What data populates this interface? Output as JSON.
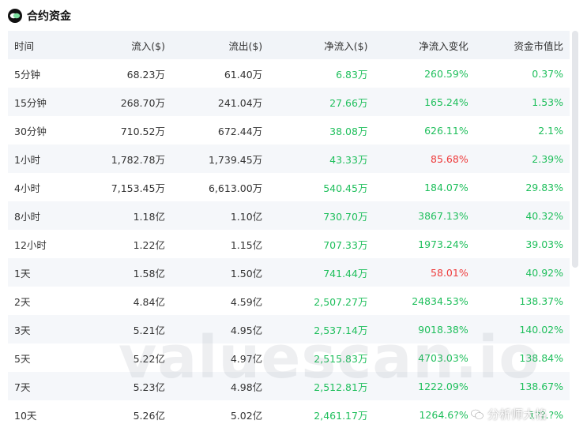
{
  "header": {
    "title": "合约资金"
  },
  "table": {
    "columns": [
      "时间",
      "流入($)",
      "流出($)",
      "净流入($)",
      "净流入变化",
      "资金市值比"
    ],
    "rows": [
      {
        "time": "5分钟",
        "inflow": "68.23万",
        "outflow": "61.40万",
        "net": "6.83万",
        "change": "260.59%",
        "ratio": "0.37%"
      },
      {
        "time": "15分钟",
        "inflow": "268.70万",
        "outflow": "241.04万",
        "net": "27.66万",
        "change": "165.24%",
        "ratio": "1.53%"
      },
      {
        "time": "30分钟",
        "inflow": "710.52万",
        "outflow": "672.44万",
        "net": "38.08万",
        "change": "626.11%",
        "ratio": "2.1%"
      },
      {
        "time": "1小时",
        "inflow": "1,782.78万",
        "outflow": "1,739.45万",
        "net": "43.33万",
        "change": "85.68%",
        "ratio": "2.39%"
      },
      {
        "time": "4小时",
        "inflow": "7,153.45万",
        "outflow": "6,613.00万",
        "net": "540.45万",
        "change": "184.07%",
        "ratio": "29.83%"
      },
      {
        "time": "8小时",
        "inflow": "1.18亿",
        "outflow": "1.10亿",
        "net": "730.70万",
        "change": "3867.13%",
        "ratio": "40.32%"
      },
      {
        "time": "12小时",
        "inflow": "1.22亿",
        "outflow": "1.15亿",
        "net": "707.33万",
        "change": "1973.24%",
        "ratio": "39.03%"
      },
      {
        "time": "1天",
        "inflow": "1.58亿",
        "outflow": "1.50亿",
        "net": "741.44万",
        "change": "58.01%",
        "ratio": "40.92%"
      },
      {
        "time": "2天",
        "inflow": "4.84亿",
        "outflow": "4.59亿",
        "net": "2,507.27万",
        "change": "24834.53%",
        "ratio": "138.37%"
      },
      {
        "time": "3天",
        "inflow": "5.21亿",
        "outflow": "4.95亿",
        "net": "2,537.14万",
        "change": "9018.38%",
        "ratio": "140.02%"
      },
      {
        "time": "5天",
        "inflow": "5.22亿",
        "outflow": "4.97亿",
        "net": "2,515.83万",
        "change": "4703.03%",
        "ratio": "138.84%"
      },
      {
        "time": "7天",
        "inflow": "5.23亿",
        "outflow": "4.98亿",
        "net": "2,512.81万",
        "change": "1222.09%",
        "ratio": "138.67%"
      },
      {
        "time": "10天",
        "inflow": "5.26亿",
        "outflow": "5.02亿",
        "net": "2,461.17万",
        "change": "1264.6?%",
        "ratio": "1??.?%"
      }
    ]
  },
  "colors": {
    "positive": "#1fbf5c",
    "negative": "#ee3b3b",
    "header_bg": "#f1f4f8",
    "stripe_bg": "#f5f7fa"
  },
  "watermark": {
    "text": "valuescan.io"
  },
  "footer_badge": {
    "icon": "wechat-icon",
    "text": "分析师大格"
  }
}
